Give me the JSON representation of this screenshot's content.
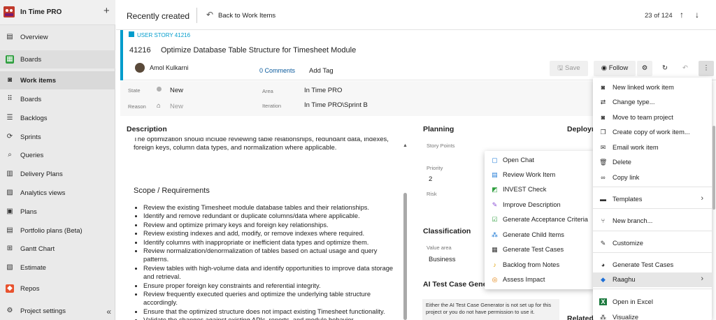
{
  "project": {
    "logo_text": "IN TIME PRO",
    "name": "In Time PRO",
    "add": "+"
  },
  "sidebar": {
    "items": [
      {
        "label": "Overview",
        "icon": "overview-icon",
        "glyph": "▤"
      },
      {
        "label": "Boards",
        "icon": "boards-icon",
        "glyph": "▦"
      },
      {
        "label": "Work items",
        "icon": "work-items-icon",
        "glyph": "◙"
      },
      {
        "label": "Boards",
        "icon": "board-icon",
        "glyph": "⠿"
      },
      {
        "label": "Backlogs",
        "icon": "backlogs-icon",
        "glyph": "☰"
      },
      {
        "label": "Sprints",
        "icon": "sprints-icon",
        "glyph": "⟳"
      },
      {
        "label": "Queries",
        "icon": "queries-icon",
        "glyph": "⌕"
      },
      {
        "label": "Delivery Plans",
        "icon": "delivery-plans-icon",
        "glyph": "▥"
      },
      {
        "label": "Analytics views",
        "icon": "analytics-icon",
        "glyph": "▨"
      },
      {
        "label": "Plans",
        "icon": "plans-icon",
        "glyph": "▣"
      },
      {
        "label": "Portfolio plans (Beta)",
        "icon": "portfolio-icon",
        "glyph": "▤"
      },
      {
        "label": "Gantt Chart",
        "icon": "gantt-icon",
        "glyph": "⊞"
      },
      {
        "label": "Estimate",
        "icon": "estimate-icon",
        "glyph": "▧"
      },
      {
        "label": "Repos",
        "icon": "repos-icon",
        "glyph": "◆"
      },
      {
        "label": "Project settings",
        "icon": "settings-icon",
        "glyph": "⚙"
      }
    ],
    "collapse": "«"
  },
  "header": {
    "recent": "Recently created",
    "back": "Back to Work Items",
    "count": "23 of 124",
    "up": "↑",
    "down": "↓"
  },
  "workitem": {
    "type": "USER STORY 41216",
    "id": "41216",
    "title": "Optimize Database Table Structure for Timesheet Module",
    "assignee": "Amol Kulkarni",
    "comments": "0 Comments",
    "add_tag": "Add Tag",
    "save": "Save",
    "follow": "Follow"
  },
  "fields": {
    "state_label": "State",
    "state": "New",
    "reason_label": "Reason",
    "reason": "New",
    "area_label": "Area",
    "area": "In Time PRO",
    "iteration_label": "Iteration",
    "iteration": "In Time PRO\\Sprint B"
  },
  "description": {
    "heading": "Description",
    "top_text": "The optimization should include reviewing table relationships, redundant data, indexes, foreign keys, column data types, and normalization where applicable.",
    "scope_heading": "Scope / Requirements",
    "bullets": [
      "Review the existing Timesheet module database tables and their relationships.",
      "Identify and remove redundant or duplicate columns/data where applicable.",
      "Review and optimize primary keys and foreign key relationships.",
      "Review existing indexes and add, modify, or remove indexes where required.",
      "Identify columns with inappropriate or inefficient data types and optimize them.",
      "Review normalization/denormalization of tables based on actual usage and query patterns.",
      "Review tables with high-volume data and identify opportunities to improve data storage and retrieval.",
      "Ensure proper foreign key constraints and referential integrity.",
      "Review frequently executed queries and optimize the underlying table structure accordingly.",
      "Ensure that the optimized structure does not impact existing Timesheet functionality.",
      "Validate the changes against existing APIs, reports, and module behavior."
    ]
  },
  "planning": {
    "heading": "Planning",
    "story_points_label": "Story Points",
    "priority_label": "Priority",
    "priority": "2",
    "risk_label": "Risk",
    "deploy_heading": "Deploym",
    "classification_heading": "Classification",
    "value_area_label": "Value area",
    "value_area": "Business",
    "ai_heading": "AI Test Case Gener",
    "ai_text": "Either the AI Test Case Generator is not set up for this project or you do not have permission to use it.",
    "related_heading": "Related"
  },
  "submenu": {
    "items": [
      {
        "label": "Open Chat",
        "icon": "chat-icon",
        "glyph": "▢",
        "color": "#1e7ad6"
      },
      {
        "label": "Review Work Item",
        "icon": "review-icon",
        "glyph": "▤",
        "color": "#1e7ad6"
      },
      {
        "label": "INVEST Check",
        "icon": "invest-icon",
        "glyph": "◩",
        "color": "#2e9e3e"
      },
      {
        "label": "Improve Description",
        "icon": "improve-icon",
        "glyph": "✎",
        "color": "#8b4fd6"
      },
      {
        "label": "Generate Acceptance Criteria",
        "icon": "acceptance-icon",
        "glyph": "☑",
        "color": "#2e9e3e"
      },
      {
        "label": "Generate Child Items",
        "icon": "child-items-icon",
        "glyph": "⁂",
        "color": "#1e7ad6"
      },
      {
        "label": "Generate Test Cases",
        "icon": "test-cases-icon",
        "glyph": "▦",
        "color": "#333333"
      },
      {
        "label": "Backlog from Notes",
        "icon": "notes-icon",
        "glyph": "♪",
        "color": "#e0a000"
      },
      {
        "label": "Assess Impact",
        "icon": "impact-icon",
        "glyph": "◎",
        "color": "#e07b00"
      }
    ]
  },
  "mainmenu": {
    "items": [
      {
        "label": "New linked work item",
        "icon": "new-linked-icon",
        "glyph": "◙"
      },
      {
        "label": "Change type...",
        "icon": "change-type-icon",
        "glyph": "⇄"
      },
      {
        "label": "Move to team project",
        "icon": "move-icon",
        "glyph": "◙"
      },
      {
        "label": "Create copy of work item...",
        "icon": "copy-icon",
        "glyph": "❐"
      },
      {
        "label": "Email work item",
        "icon": "email-icon",
        "glyph": "✉"
      },
      {
        "label": "Delete",
        "icon": "delete-icon",
        "glyph": "🗑"
      },
      {
        "label": "Copy link",
        "icon": "link-icon",
        "glyph": "∞"
      },
      {
        "label": "Templates",
        "icon": "templates-icon",
        "glyph": "▬",
        "arrow": "›"
      },
      {
        "label": "New branch...",
        "icon": "branch-icon",
        "glyph": "⑂"
      },
      {
        "label": "Customize",
        "icon": "customize-icon",
        "glyph": "✎"
      },
      {
        "label": "Generate Test Cases",
        "icon": "generate-icon",
        "glyph": "◕"
      },
      {
        "label": "Raaghu",
        "icon": "raaghu-icon",
        "glyph": "◆",
        "arrow": "›"
      },
      {
        "label": "Open in Excel",
        "icon": "excel-icon",
        "glyph": "X"
      },
      {
        "label": "Visualize",
        "icon": "visualize-icon",
        "glyph": "⁂"
      }
    ]
  },
  "colors": {
    "accent": "#009ccc",
    "repos": "#e8522e",
    "boards": "#2e9e3e"
  }
}
